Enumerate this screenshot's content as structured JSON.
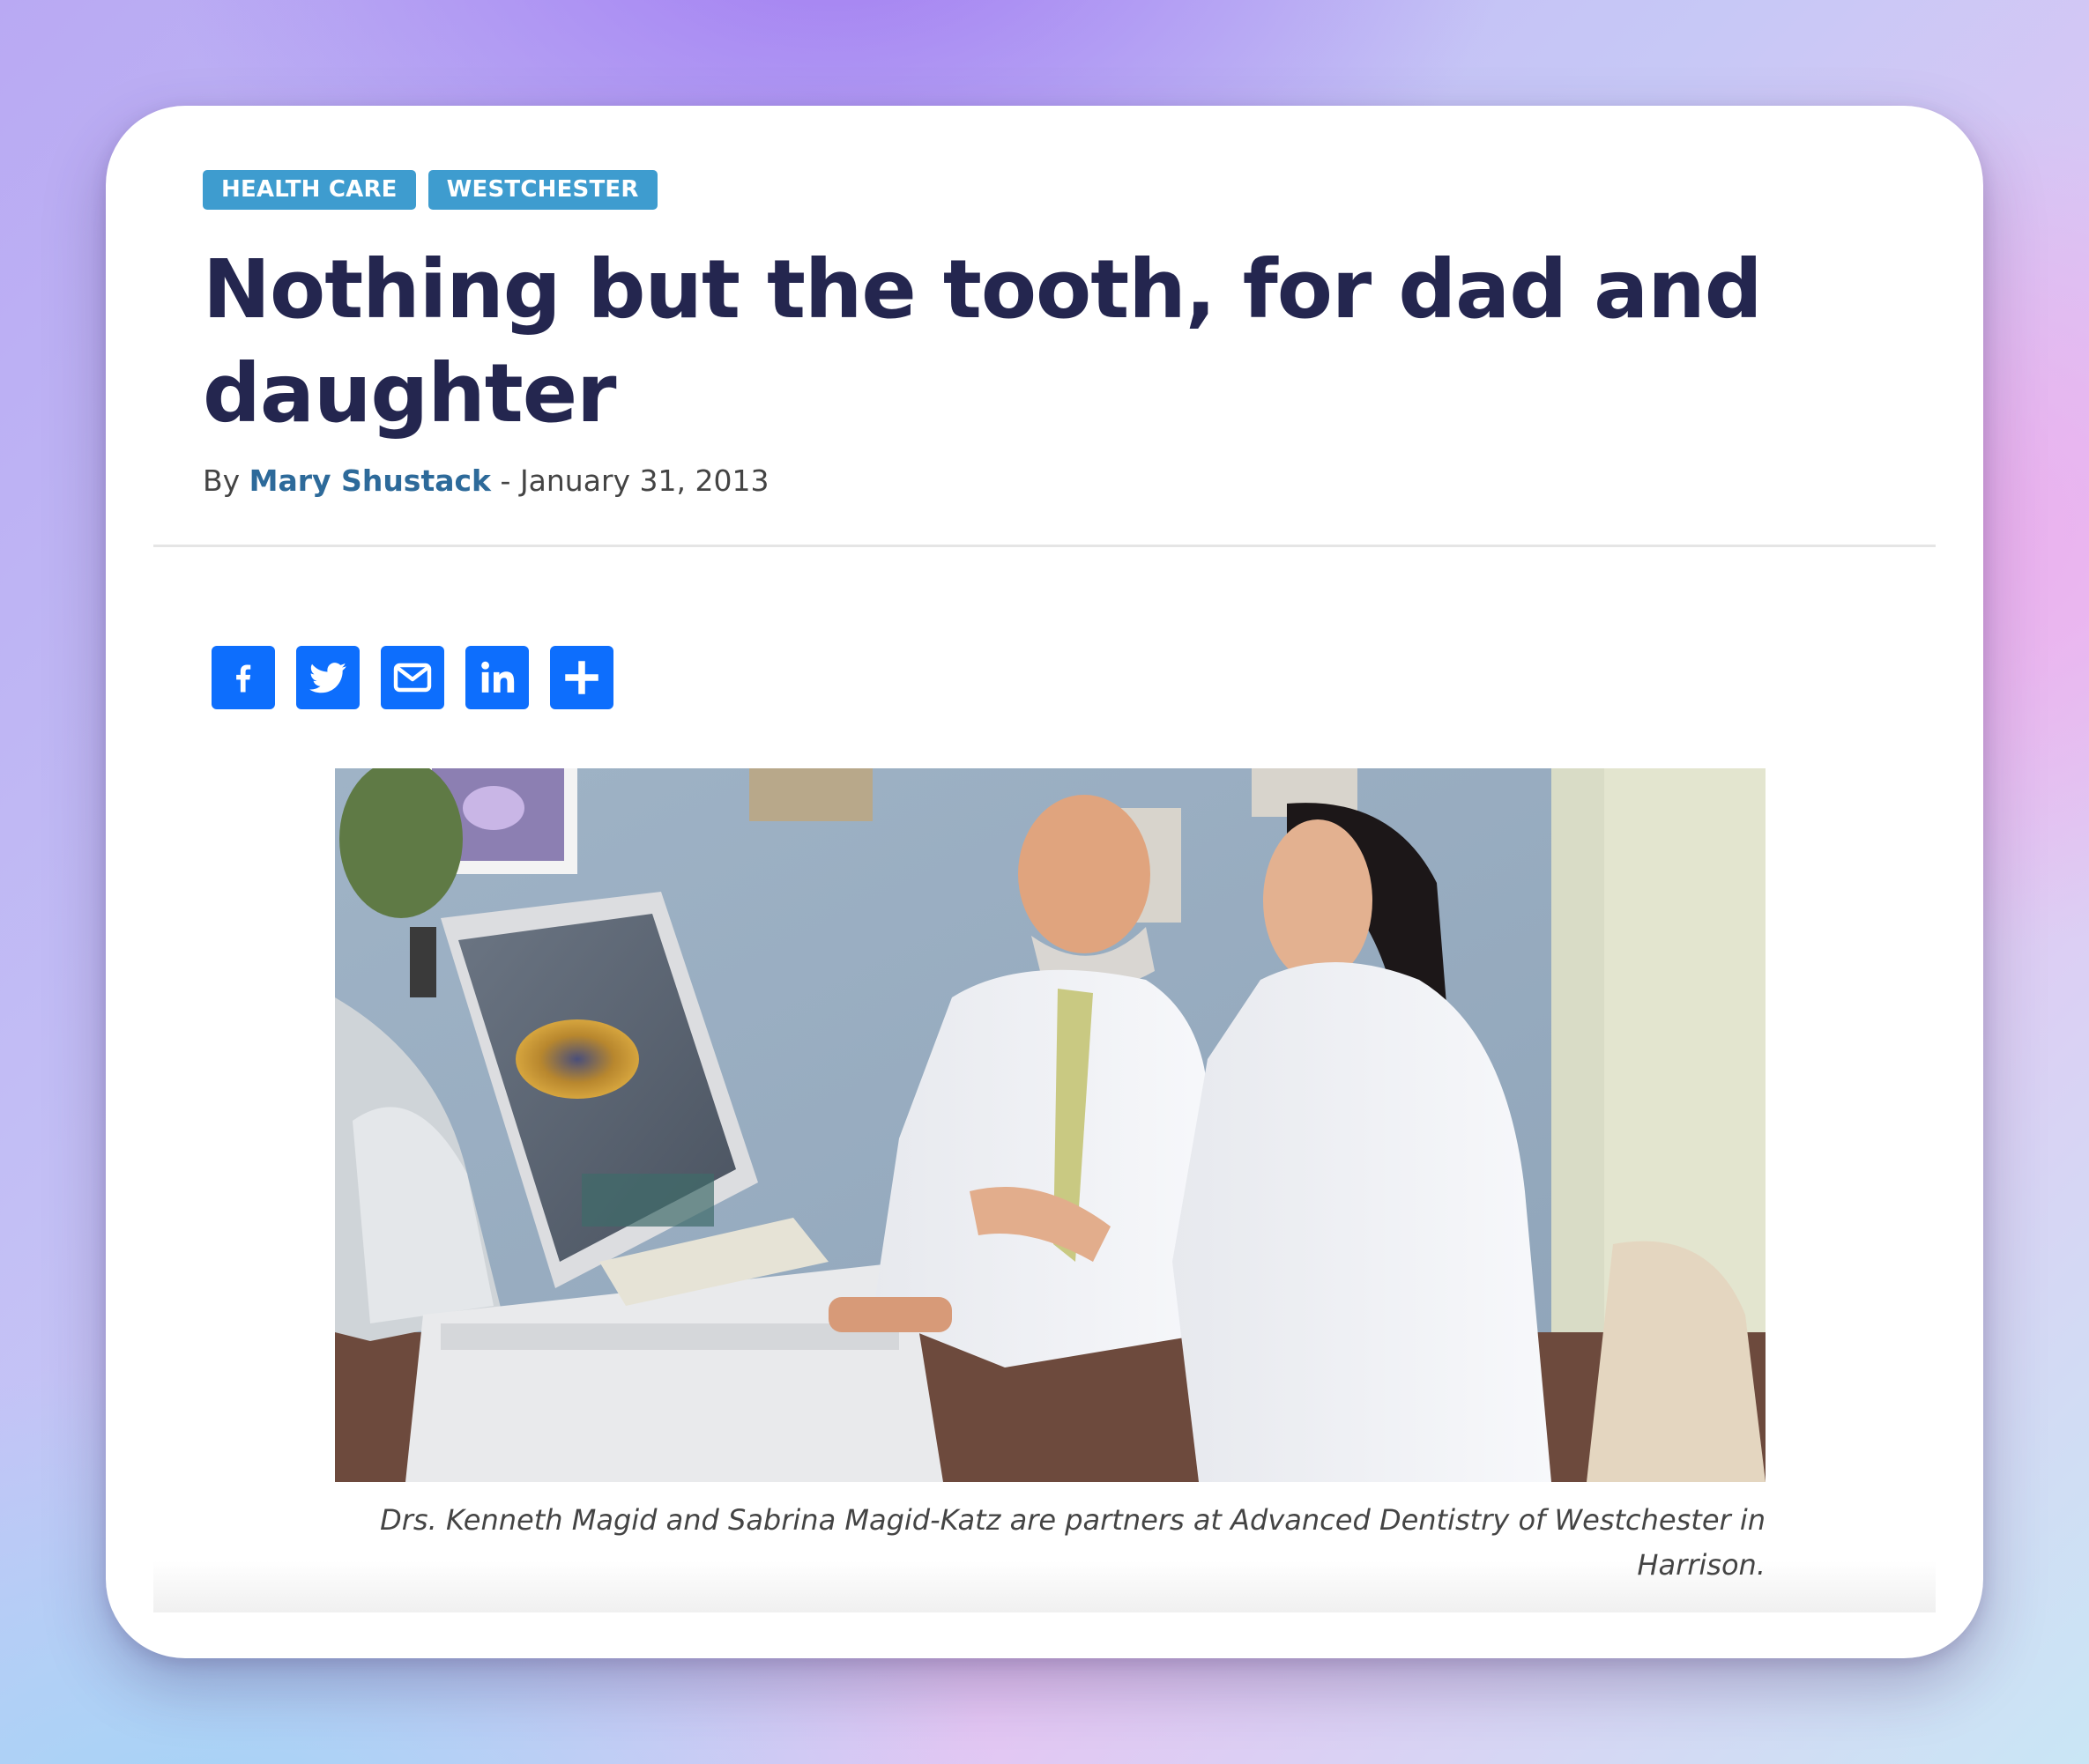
{
  "article": {
    "tags": [
      "HEALTH CARE",
      "WESTCHESTER"
    ],
    "headline": "Nothing but the tooth, for dad and daughter",
    "byline_prefix": "By",
    "author": "Mary Shustack",
    "separator": "-",
    "date": "January 31, 2013"
  },
  "share_buttons": [
    {
      "icon": "facebook-icon"
    },
    {
      "icon": "twitter-icon"
    },
    {
      "icon": "email-icon"
    },
    {
      "icon": "linkedin-icon"
    },
    {
      "icon": "share-plus-icon"
    }
  ],
  "photo": {
    "caption": "Drs. Kenneth Magid and Sabrina Magid-Katz are partners at Advanced Dentistry of Westchester in Harrison."
  },
  "colors": {
    "tag_bg": "#3e9ccf",
    "headline": "#24264f",
    "author_link": "#2d6a9a",
    "share_button": "#0d6efd"
  }
}
